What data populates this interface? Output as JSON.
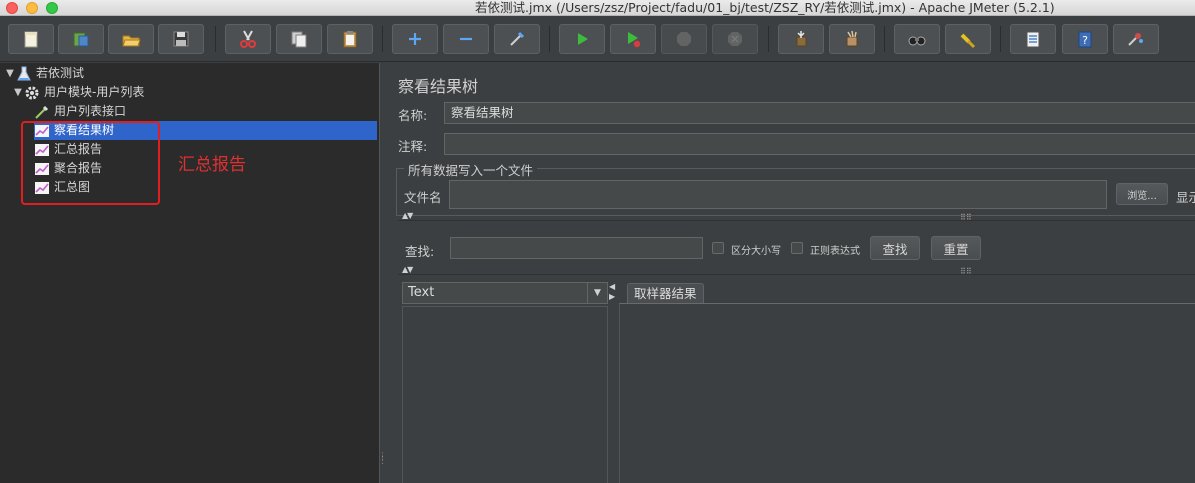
{
  "window": {
    "title": "若依测试.jmx (/Users/zsz/Project/fadu/01_bj/test/ZSZ_RY/若依测试.jmx) - Apache JMeter (5.2.1)"
  },
  "toolbar": {
    "buttons": [
      {
        "name": "new-icon"
      },
      {
        "name": "templates-icon"
      },
      {
        "name": "open-icon"
      },
      {
        "name": "save-icon"
      },
      {
        "name": "cut-icon"
      },
      {
        "name": "copy-icon"
      },
      {
        "name": "paste-icon"
      },
      {
        "name": "expand-icon"
      },
      {
        "name": "collapse-icon"
      },
      {
        "name": "toggle-icon"
      },
      {
        "name": "start-icon"
      },
      {
        "name": "start-no-pauses-icon"
      },
      {
        "name": "stop-icon"
      },
      {
        "name": "shutdown-icon"
      },
      {
        "name": "clear-icon"
      },
      {
        "name": "clear-all-icon"
      },
      {
        "name": "search-icon"
      },
      {
        "name": "reset-search-icon"
      },
      {
        "name": "function-helper-icon"
      },
      {
        "name": "help-icon"
      },
      {
        "name": "remote-icon"
      }
    ]
  },
  "tree": {
    "nodes": [
      {
        "label": "若依测试",
        "icon": "test-plan-icon",
        "expanded": true
      },
      {
        "label": "用户模块-用户列表",
        "icon": "thread-group-gear-icon",
        "expanded": true
      },
      {
        "label": "用户列表接口",
        "icon": "sampler-pipette-icon"
      },
      {
        "label": "察看结果树",
        "icon": "listener-graph-icon",
        "selected": true
      },
      {
        "label": "汇总报告",
        "icon": "listener-graph-icon"
      },
      {
        "label": "聚合报告",
        "icon": "listener-graph-icon"
      },
      {
        "label": "汇总图",
        "icon": "listener-graph-icon"
      }
    ],
    "annotation": "汇总报告",
    "annotation_color": "#e03030"
  },
  "panel": {
    "title": "察看结果树",
    "name_label": "名称:",
    "name_value": "察看结果树",
    "comment_label": "注释:",
    "comment_value": "",
    "file_group_legend": "所有数据写入一个文件",
    "filename_label": "文件名",
    "filename_value": "",
    "browse_button": "浏览...",
    "display_label_cut": "显示",
    "search_label": "查找:",
    "search_value": "",
    "case_sensitive_label": "区分大小写",
    "regex_label": "正则表达式",
    "find_button": "查找",
    "reset_button": "重置",
    "renderer_select": "Text",
    "result_tab": "取样器结果"
  },
  "colors": {
    "selected_row": "#2f65ca",
    "background": "#3c3f41",
    "tree_background": "#2b2b2b"
  }
}
